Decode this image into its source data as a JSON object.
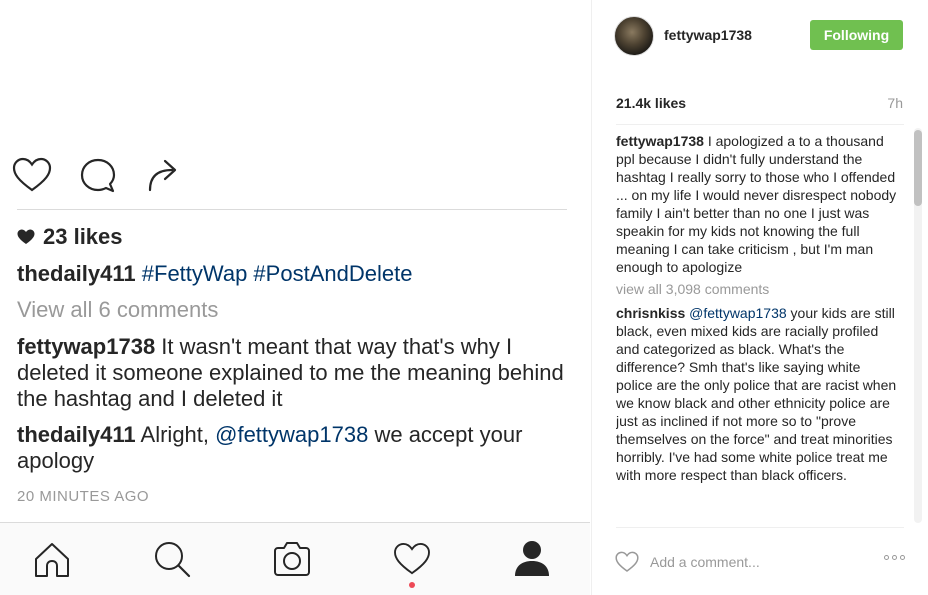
{
  "left": {
    "likes": "23 likes",
    "caption": {
      "user": "thedaily411",
      "tags": "#FettyWap #PostAndDelete"
    },
    "view_all": "View all 6 comments",
    "comments": [
      {
        "user": "fettywap1738",
        "text": " It wasn't meant that way that's why I deleted it someone explained to me the meaning behind the hashtag and I deleted it"
      },
      {
        "user": "thedaily411",
        "pre": " Alright, ",
        "mention": "@fettywap1738",
        "post": " we accept your apology"
      }
    ],
    "timestamp": "20 MINUTES AGO"
  },
  "right": {
    "username": "fettywap1738",
    "follow_label": "Following",
    "likes": "21.4k likes",
    "time": "7h",
    "caption": {
      "user": "fettywap1738",
      "text": " I apologized a to a thousand ppl because I didn't fully understand the hashtag I really sorry to those who I offended ... on my life I would never disrespect nobody family I ain't better than no one I just was speakin for my kids not knowing the full meaning I can take criticism , but I'm man enough to apologize"
    },
    "view_all": "view all 3,098 comments",
    "comments": [
      {
        "user": "chrisnkiss",
        "mention": "@fettywap1738",
        "text": " your kids are still black, even mixed kids are racially profiled and categorized as black. What's the difference? Smh that's like saying white police are the only police that are racist when we know black and other ethnicity police are just as inclined if not more so to \"prove themselves on the force\" and treat minorities horribly. I've had some white police treat me with more respect than black officers."
      }
    ],
    "add_comment_placeholder": "Add a comment..."
  },
  "colors": {
    "follow_green": "#70c050",
    "link_blue": "#003569",
    "muted_gray": "#999999",
    "notification_red": "#ed4956"
  }
}
